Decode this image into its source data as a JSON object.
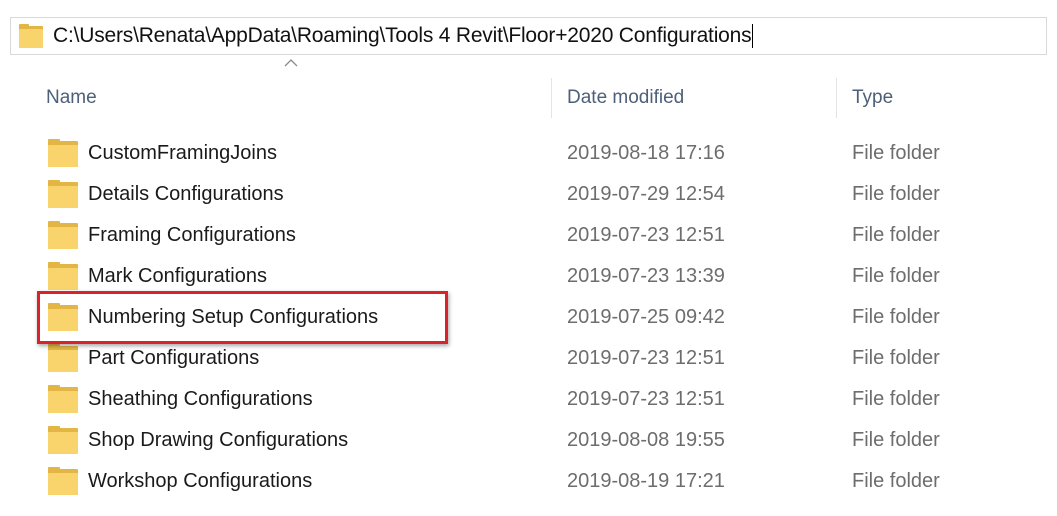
{
  "address_bar": {
    "path": "C:\\Users\\Renata\\AppData\\Roaming\\Tools 4 Revit\\Floor+2020 Configurations"
  },
  "columns": {
    "name": "Name",
    "date_modified": "Date modified",
    "type": "Type"
  },
  "rows": [
    {
      "name": "CustomFramingJoins",
      "date": "2019-08-18 17:16",
      "type": "File folder"
    },
    {
      "name": "Details Configurations",
      "date": "2019-07-29 12:54",
      "type": "File folder"
    },
    {
      "name": "Framing Configurations",
      "date": "2019-07-23 12:51",
      "type": "File folder"
    },
    {
      "name": "Mark Configurations",
      "date": "2019-07-23 13:39",
      "type": "File folder"
    },
    {
      "name": "Numbering Setup Configurations",
      "date": "2019-07-25 09:42",
      "type": "File folder"
    },
    {
      "name": "Part Configurations",
      "date": "2019-07-23 12:51",
      "type": "File folder"
    },
    {
      "name": "Sheathing Configurations",
      "date": "2019-07-23 12:51",
      "type": "File folder"
    },
    {
      "name": "Shop Drawing Configurations",
      "date": "2019-08-08 19:55",
      "type": "File folder"
    },
    {
      "name": "Workshop Configurations",
      "date": "2019-08-19 17:21",
      "type": "File folder"
    }
  ],
  "highlighted_row": "Numbering Setup Configurations",
  "icons": {
    "folder": "folder-icon",
    "sort": "sort-up-chevron-icon"
  },
  "colors": {
    "folder_front": "#f9d36c",
    "folder_back": "#e2b544",
    "header_text": "#4c607a",
    "highlight_border": "#d8232a"
  }
}
